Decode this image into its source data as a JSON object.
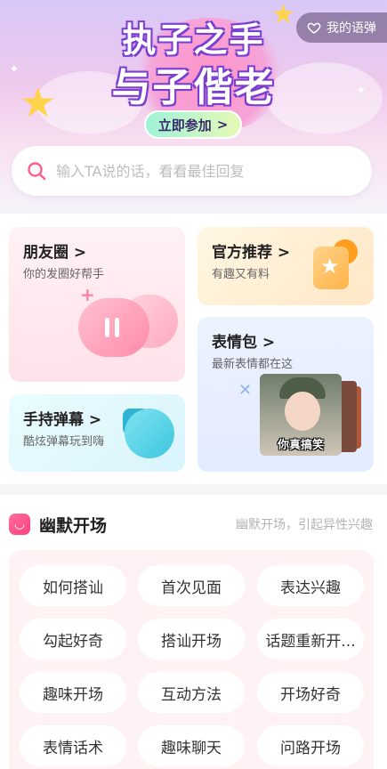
{
  "banner": {
    "title_line1": "执子之手",
    "title_line2": "与子偕老",
    "join_label": "立即参加",
    "join_chevron": ">",
    "my_button_label": "我的语弹",
    "my_button_icon": "heart-outline-icon"
  },
  "search": {
    "placeholder": "输入TA说的话，看看最佳回复",
    "icon": "search-icon"
  },
  "cards": {
    "friends": {
      "title": "朋友圈",
      "chevron": ">",
      "subtitle": "你的发圈好帮手"
    },
    "official": {
      "title": "官方推荐",
      "chevron": ">",
      "subtitle": "有趣又有料"
    },
    "emoji": {
      "title": "表情包",
      "chevron": ">",
      "subtitle": "最新表情都在这",
      "image_caption": "你真搞笑"
    },
    "danmu": {
      "title": "手持弹幕",
      "chevron": ">",
      "subtitle": "酷炫弹幕玩到嗨"
    }
  },
  "humor": {
    "title": "幽默开场",
    "subtitle": "幽默开场，引起异性兴趣",
    "tags": [
      "如何搭讪",
      "首次见面",
      "表达兴趣",
      "勾起好奇",
      "搭讪开场",
      "话题重新开...",
      "趣味开场",
      "互动方法",
      "开场好奇",
      "表情话术",
      "趣味聊天",
      "问路开场"
    ]
  },
  "colors": {
    "accent_pink": "#ff5b8c",
    "banner_purple": "#7a3fd0",
    "join_button_green": "#9ff3d9"
  }
}
